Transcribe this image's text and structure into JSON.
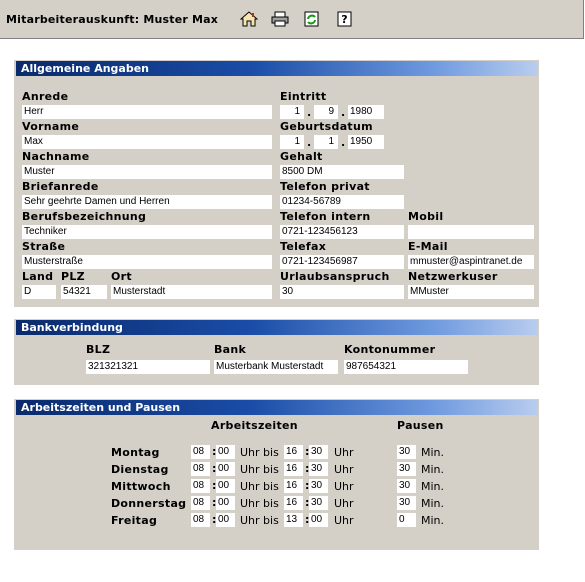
{
  "title": "Mitarbeiterauskunft: Muster Max",
  "toolbar": {
    "icons": [
      "home-icon",
      "printer-icon",
      "refresh-icon",
      "help-icon"
    ]
  },
  "general": {
    "header": "Allgemeine Angaben",
    "anrede_label": "Anrede",
    "anrede": "Herr",
    "eintritt_label": "Eintritt",
    "eintritt_d": "1",
    "eintritt_m": "9",
    "eintritt_y": "1980",
    "vorname_label": "Vorname",
    "vorname": "Max",
    "geburt_label": "Geburtsdatum",
    "geburt_d": "1",
    "geburt_m": "1",
    "geburt_y": "1950",
    "nachname_label": "Nachname",
    "nachname": "Muster",
    "gehalt_label": "Gehalt",
    "gehalt": "8500 DM",
    "briefanrede_label": "Briefanrede",
    "briefanrede": "Sehr geehrte Damen und Herren",
    "telprivat_label": "Telefon privat",
    "telprivat": "01234-56789",
    "beruf_label": "Berufsbezeichnung",
    "beruf": "Techniker",
    "telintern_label": "Telefon intern",
    "telintern": "0721-123456123",
    "mobil_label": "Mobil",
    "mobil": "",
    "strasse_label": "Straße",
    "strasse": "Musterstraße",
    "telefax_label": "Telefax",
    "telefax": "0721-123456987",
    "email_label": "E-Mail",
    "email": "mmuster@aspintranet.de",
    "land_label": "Land",
    "land": "D",
    "plz_label": "PLZ",
    "plz": "54321",
    "ort_label": "Ort",
    "ort": "Musterstadt",
    "urlaub_label": "Urlaubsanspruch",
    "urlaub": "30",
    "netz_label": "Netzwerkuser",
    "netz": "MMuster"
  },
  "bank": {
    "header": "Bankverbindung",
    "blz_label": "BLZ",
    "blz": "321321321",
    "bank_label": "Bank",
    "bank": "Musterbank Musterstadt",
    "konto_label": "Kontonummer",
    "konto": "987654321"
  },
  "times": {
    "header": "Arbeitszeiten und Pausen",
    "col_work": "Arbeitszeiten",
    "col_pause": "Pausen",
    "uhr_bis": "Uhr bis",
    "uhr": "Uhr",
    "min": "Min.",
    "days": [
      {
        "day": "Montag",
        "from_h": "08",
        "from_m": "00",
        "to_h": "16",
        "to_m": "30",
        "pause": "30"
      },
      {
        "day": "Dienstag",
        "from_h": "08",
        "from_m": "00",
        "to_h": "16",
        "to_m": "30",
        "pause": "30"
      },
      {
        "day": "Mittwoch",
        "from_h": "08",
        "from_m": "00",
        "to_h": "16",
        "to_m": "30",
        "pause": "30"
      },
      {
        "day": "Donnerstag",
        "from_h": "08",
        "from_m": "00",
        "to_h": "16",
        "to_m": "30",
        "pause": "30"
      },
      {
        "day": "Freitag",
        "from_h": "08",
        "from_m": "00",
        "to_h": "13",
        "to_m": "00",
        "pause": "0"
      }
    ]
  }
}
